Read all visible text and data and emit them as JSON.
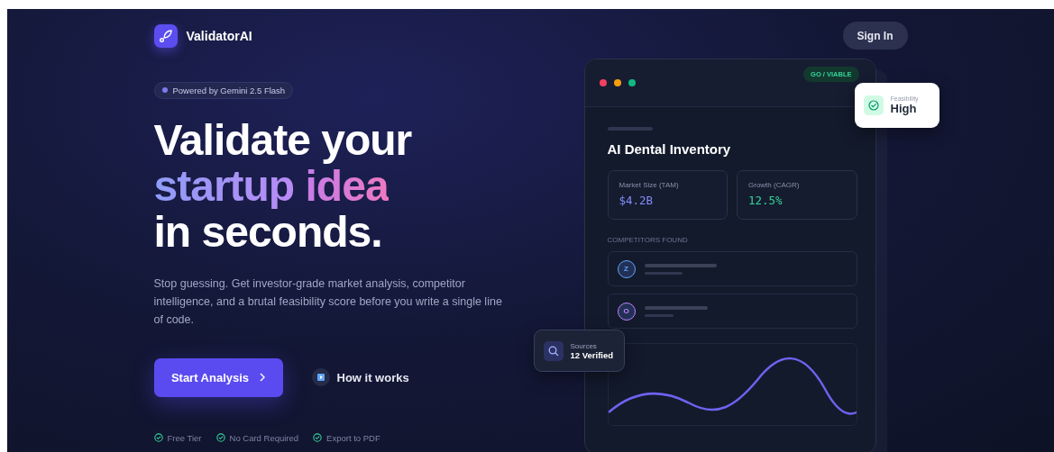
{
  "header": {
    "brand": "ValidatorAI",
    "sign_in": "Sign In"
  },
  "hero": {
    "badge": "Powered by Gemini 2.5 Flash",
    "headline": [
      {
        "text": "Validate your",
        "kind": "plain"
      },
      {
        "text": "startup",
        "kind": "lavender"
      },
      {
        "text": "idea",
        "kind": "pink"
      },
      {
        "text": "in seconds.",
        "kind": "plain"
      }
    ],
    "description": "Stop guessing. Get investor-grade market analysis, competitor intelligence, and a brutal feasibility score before you write a single line of code.",
    "primary_button": "Start Analysis",
    "secondary_button": "How it works",
    "features": [
      "Free Tier",
      "No Card Required",
      "Export to PDF"
    ]
  },
  "preview": {
    "window_dots": [
      {
        "color": "#f43f5e"
      },
      {
        "color": "#f59e0b"
      },
      {
        "color": "#10b981"
      }
    ],
    "status": "GO / VIABLE",
    "title": "AI Dental Inventory",
    "metrics": [
      {
        "label": "Market Size (TAM)",
        "value": "$4.2B",
        "color": "#818cf8"
      },
      {
        "label": "Growth (CAGR)",
        "value": "12.5%",
        "color": "#34d399"
      }
    ],
    "competitors_heading": "COMPETITORS FOUND",
    "competitors": [
      {
        "initial": "Z",
        "color": "#60a5fa"
      },
      {
        "initial": "O",
        "color": "#c084fc"
      }
    ],
    "feasibility": {
      "label": "Feasibility",
      "value": "High"
    },
    "sources": {
      "label": "Sources",
      "value": "12 Verified"
    }
  }
}
